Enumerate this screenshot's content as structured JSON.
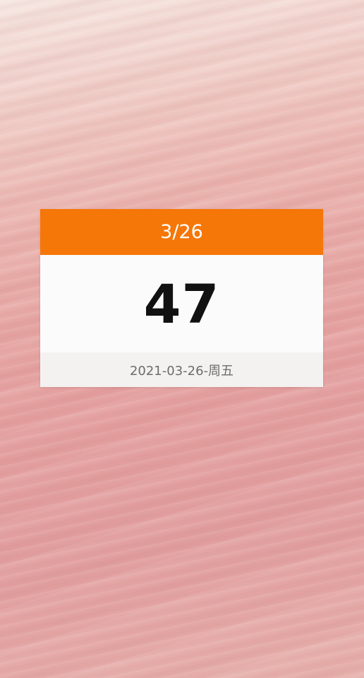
{
  "colors": {
    "header_bg": "#f57708",
    "header_text": "#ffffff",
    "body_bg": "#fbfbfb",
    "count_text": "#111111",
    "footer_bg": "#f3f2f1",
    "footer_text": "#6c6c6c",
    "wallpaper_tone": "#e4a0a0"
  },
  "widget": {
    "header_date": "3/26",
    "count": "47",
    "footer_date": "2021-03-26-周五"
  }
}
